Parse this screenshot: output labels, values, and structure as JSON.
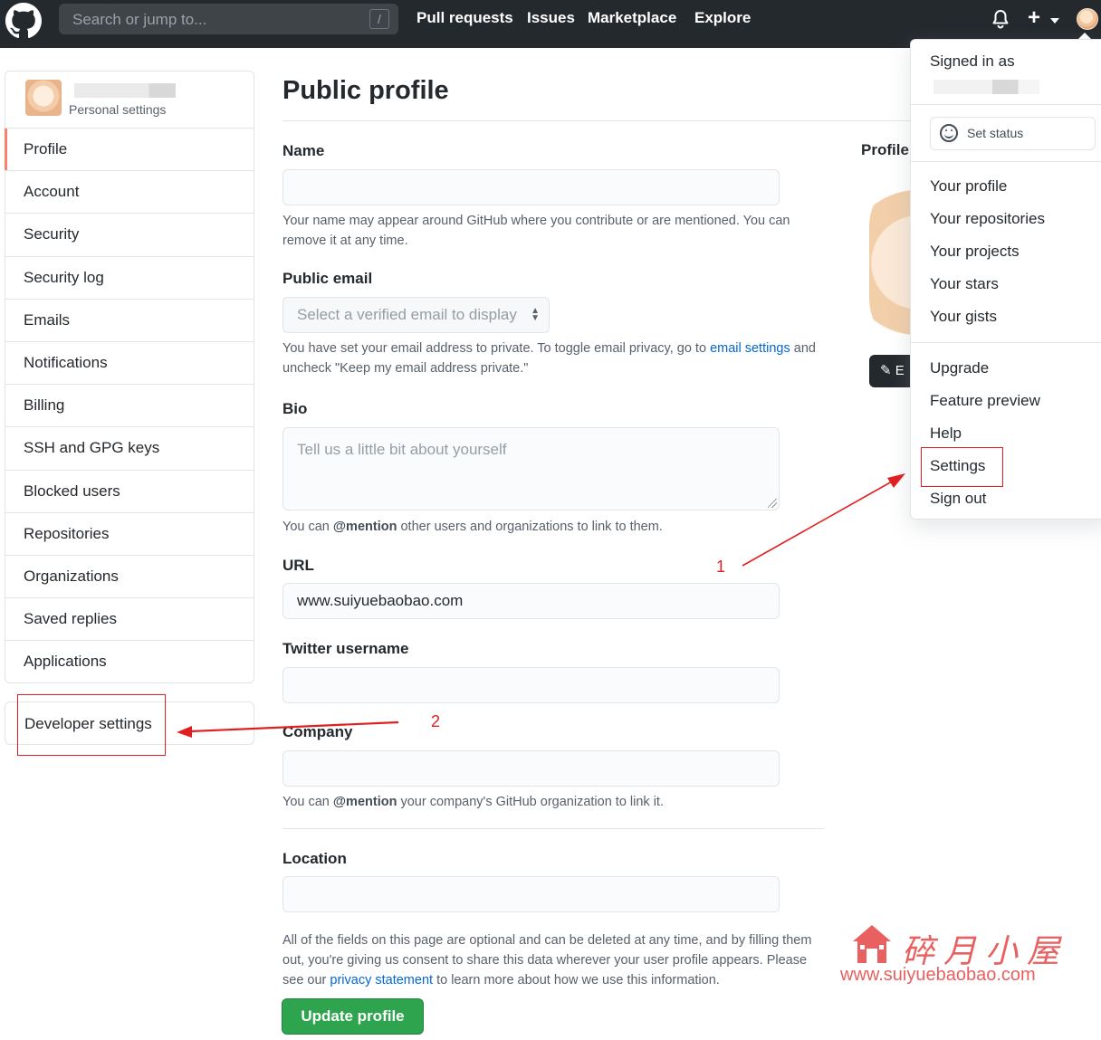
{
  "header": {
    "search_placeholder": "Search or jump to...",
    "search_shortcut": "/",
    "nav": [
      "Pull requests",
      "Issues",
      "Marketplace",
      "Explore"
    ]
  },
  "sidebar": {
    "subtitle": "Personal settings",
    "items": [
      "Profile",
      "Account",
      "Security",
      "Security log",
      "Emails",
      "Notifications",
      "Billing",
      "SSH and GPG keys",
      "Blocked users",
      "Repositories",
      "Organizations",
      "Saved replies",
      "Applications"
    ],
    "selected": "Profile",
    "developer_settings": "Developer settings"
  },
  "main": {
    "title": "Public profile",
    "name_label": "Name",
    "name_value": "",
    "name_note": "Your name may appear around GitHub where you contribute or are mentioned. You can remove it at any time.",
    "email_label": "Public email",
    "email_select": "Select a verified email to display",
    "email_note_1": "You have set your email address to private. To toggle email privacy, go to",
    "email_note_link": "email settings",
    "email_note_2": "and uncheck \"Keep my email address private.\"",
    "bio_label": "Bio",
    "bio_placeholder": "Tell us a little bit about yourself",
    "bio_note_1": "You can",
    "bio_note_mention": "@mention",
    "bio_note_2": "other users and organizations to link to them.",
    "url_label": "URL",
    "url_value": "www.suiyuebaobao.com",
    "twitter_label": "Twitter username",
    "company_label": "Company",
    "company_note_1": "You can",
    "company_note_mention": "@mention",
    "company_note_2": "your company's GitHub organization to link it.",
    "location_label": "Location",
    "footer_note_1": "All of the fields on this page are optional and can be deleted at any time, and by filling them out, you're giving us consent to share this data wherever your user profile appears. Please see our",
    "footer_note_link": "privacy statement",
    "footer_note_2": "to learn more about how we use this information.",
    "update_button": "Update profile",
    "profile_picture_label": "Profile",
    "edit_button": "E"
  },
  "dropdown": {
    "signed_in": "Signed in as",
    "set_status": "Set status",
    "group1": [
      "Your profile",
      "Your repositories",
      "Your projects",
      "Your stars",
      "Your gists"
    ],
    "group2": [
      "Upgrade",
      "Feature preview",
      "Help",
      "Settings",
      "Sign out"
    ]
  },
  "annotations": {
    "step1": "1",
    "step2": "2",
    "color": "#e02020"
  },
  "watermark": {
    "chinese": "碎月小屋",
    "url": "www.suiyuebaobao.com"
  }
}
